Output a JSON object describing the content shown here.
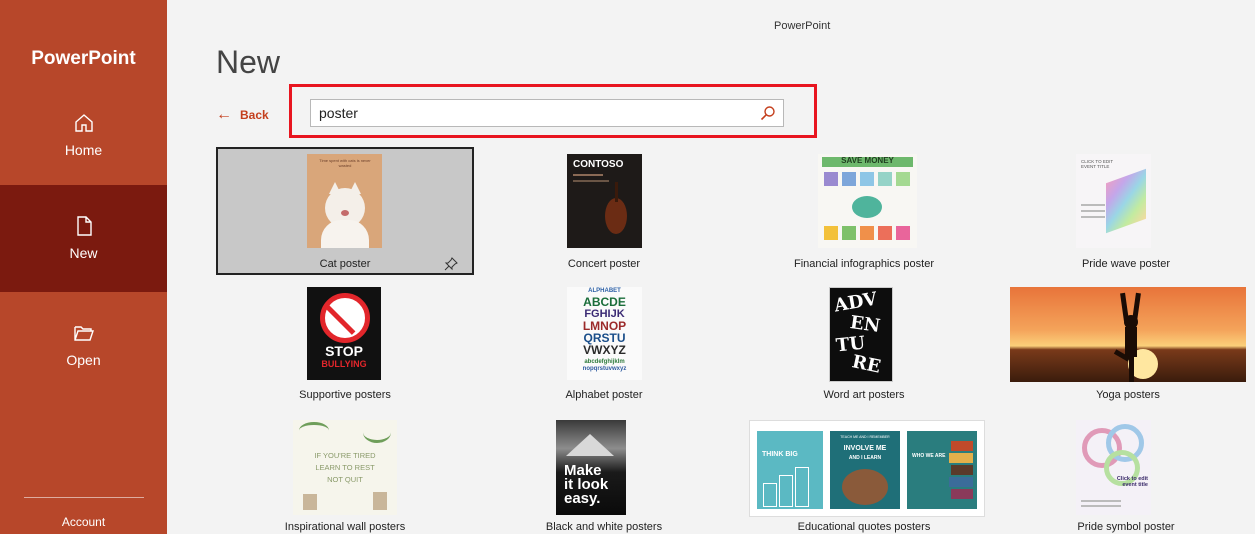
{
  "app": {
    "title": "PowerPoint"
  },
  "sidebar": {
    "brand": "PowerPoint",
    "items": [
      {
        "label": "Home",
        "icon": "home-icon"
      },
      {
        "label": "New",
        "icon": "new-document-icon",
        "active": true
      },
      {
        "label": "Open",
        "icon": "folder-icon"
      }
    ],
    "account": "Account"
  },
  "main": {
    "heading": "New",
    "back_label": "Back",
    "search": {
      "value": "poster",
      "icon": "search-icon"
    }
  },
  "templates": [
    {
      "label": "Cat poster",
      "selected": true
    },
    {
      "label": "Concert poster"
    },
    {
      "label": "Financial infographics poster"
    },
    {
      "label": "Pride wave poster"
    },
    {
      "label": "Supportive posters"
    },
    {
      "label": "Alphabet poster"
    },
    {
      "label": "Word art posters"
    },
    {
      "label": "Yoga posters"
    },
    {
      "label": "Inspirational wall posters"
    },
    {
      "label": "Black and white posters"
    },
    {
      "label": "Educational quotes posters"
    },
    {
      "label": "Pride symbol poster"
    }
  ],
  "thumb_text": {
    "cat": "Time spent with cats is never wasted",
    "concert_brand": "CONTOSO",
    "fin_title": "SAVE MONEY",
    "pride_wave": "CLICK TO EDIT EVENT TITLE",
    "stop": "STOP",
    "bullying": "BULLYING",
    "alpha_header": "ALPHABET",
    "alpha_rows": [
      "ABCDE",
      "FGHIJK",
      "LMNOP",
      "QRSTU",
      "VWXYZ",
      "abcdefghijklm",
      "nopqrstuvwxyz"
    ],
    "wordart": [
      "ADV",
      "EN",
      "TU",
      "RE"
    ],
    "inspire": [
      "IF YOU'RE TIRED",
      "LEARN TO REST",
      "NOT QUIT"
    ],
    "make": [
      "Make",
      "it look",
      "easy."
    ],
    "think_big": "THINK BIG",
    "involve": [
      "TEACH ME AND I REMEMBER",
      "INVOLVE ME",
      "AND I LEARN"
    ],
    "who_we_are": "WHO WE ARE",
    "pride_symbol": "Click to edit event title"
  },
  "colors": {
    "sidebar": "#b7472a",
    "sidebar_active": "#7b1a0f",
    "accent": "#c43e1c",
    "highlight": "#e8151f"
  }
}
